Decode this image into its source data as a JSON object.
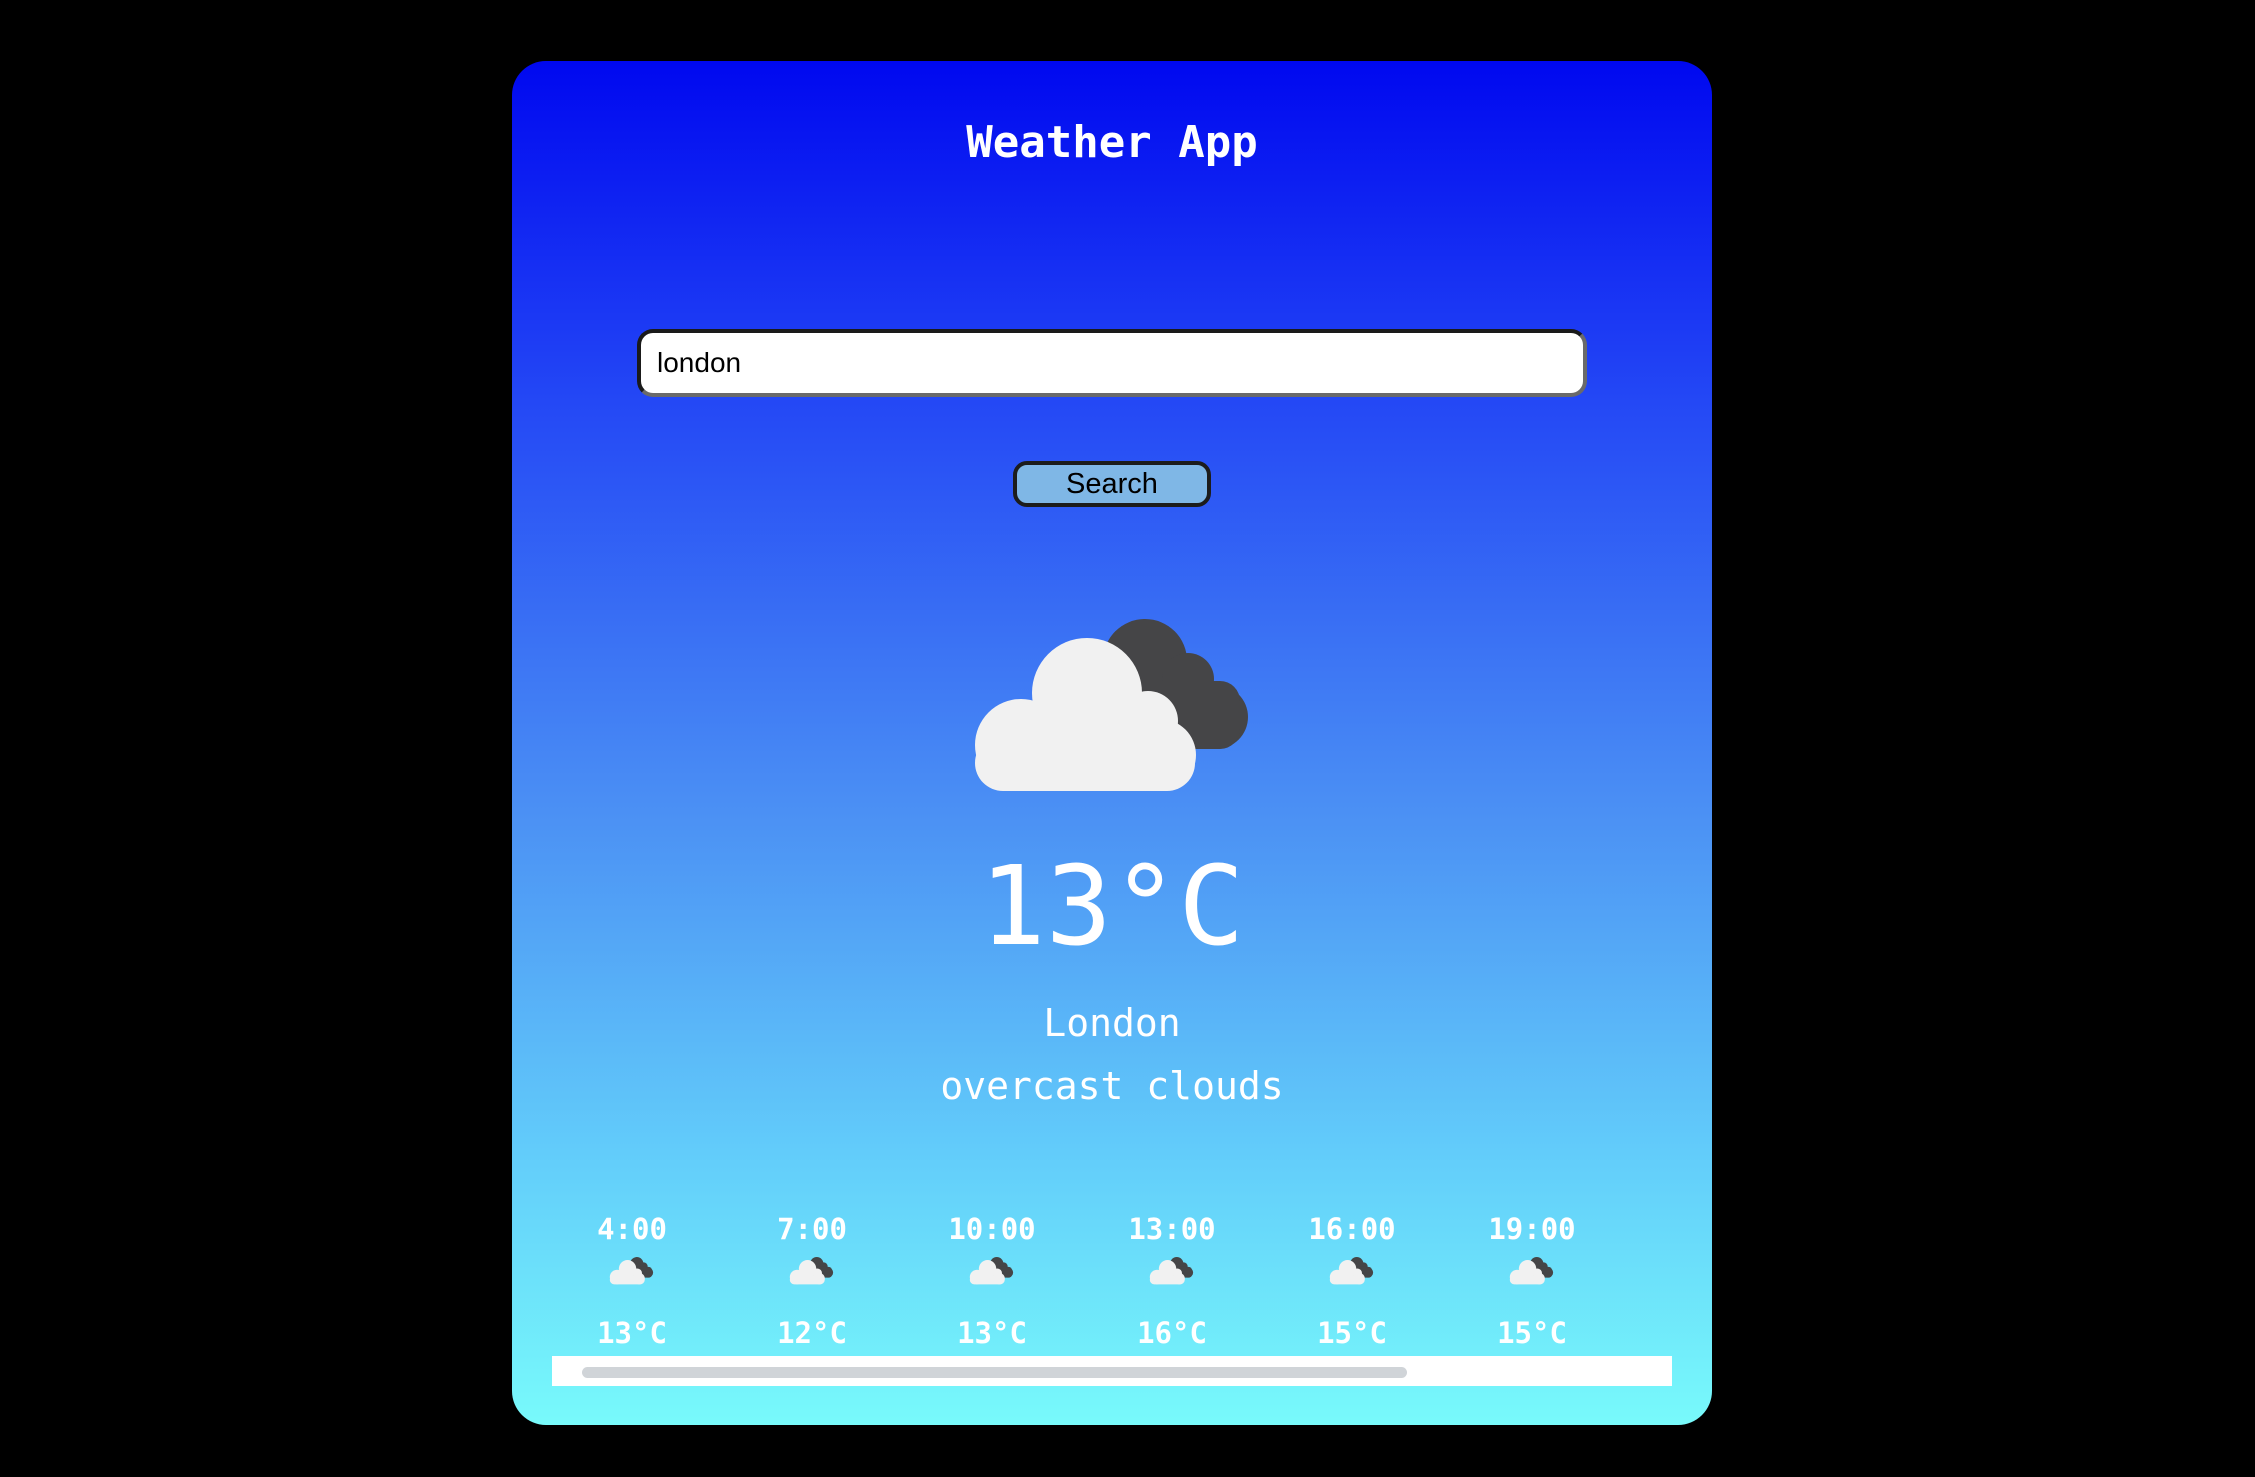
{
  "app": {
    "title": "Weather App"
  },
  "search": {
    "value": "london",
    "button_label": "Search"
  },
  "current": {
    "icon": "overcast-clouds-icon",
    "temperature": "13°C",
    "city": "London",
    "description": "overcast clouds"
  },
  "forecast": [
    {
      "time": "4:00",
      "icon": "overcast-clouds-icon",
      "temp": "13°C"
    },
    {
      "time": "7:00",
      "icon": "overcast-clouds-icon",
      "temp": "12°C"
    },
    {
      "time": "10:00",
      "icon": "overcast-clouds-icon",
      "temp": "13°C"
    },
    {
      "time": "13:00",
      "icon": "overcast-clouds-icon",
      "temp": "16°C"
    },
    {
      "time": "16:00",
      "icon": "overcast-clouds-icon",
      "temp": "15°C"
    },
    {
      "time": "19:00",
      "icon": "overcast-clouds-icon",
      "temp": "15°C"
    }
  ],
  "colors": {
    "background": "#000000",
    "gradient_top": "#0008f0",
    "gradient_bottom": "#78fafb",
    "button": "#7fb7e6",
    "cloud_light": "#f1f1f1",
    "cloud_dark": "#454547"
  }
}
